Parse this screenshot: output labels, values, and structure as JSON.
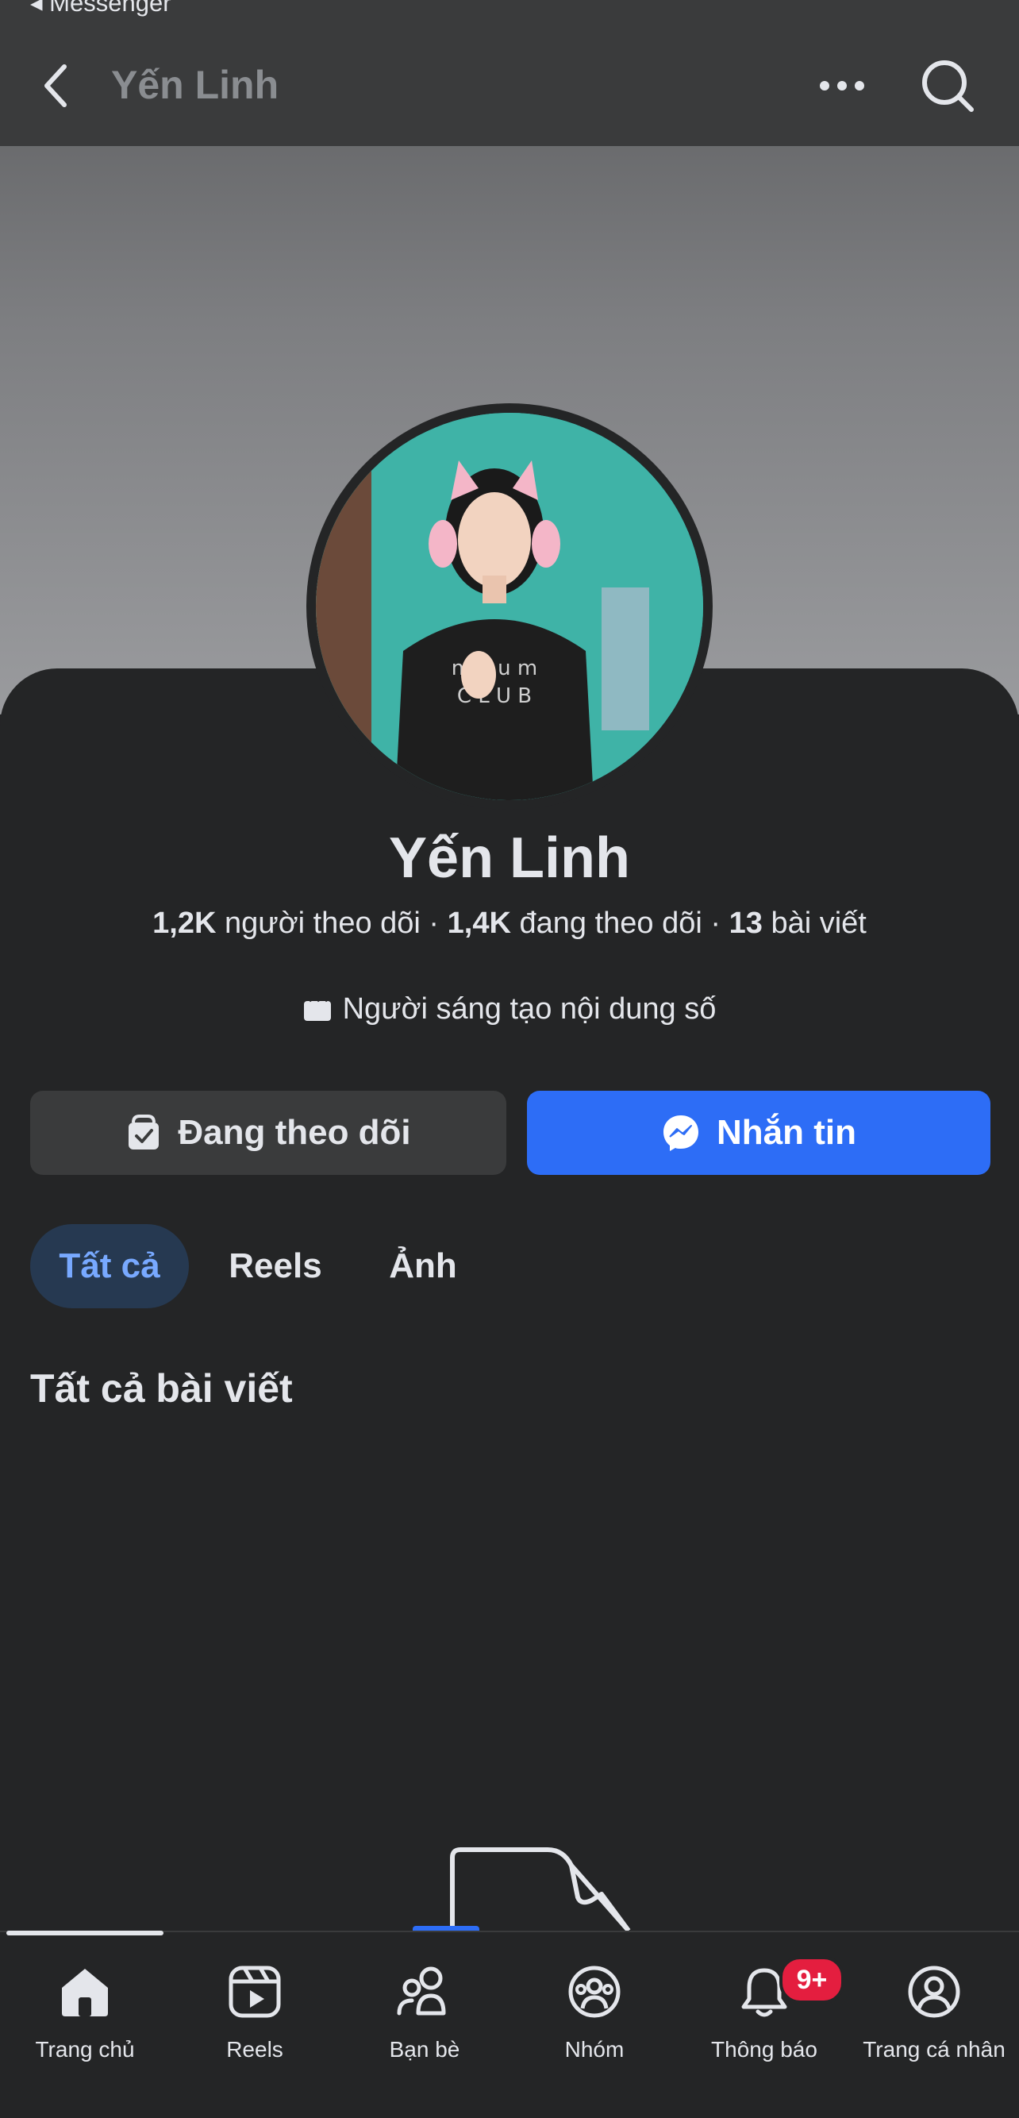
{
  "statusbar": {
    "back_app": "◂ Messenger"
  },
  "header": {
    "title": "Yến Linh"
  },
  "profile": {
    "name": "Yến Linh",
    "followers": "1,2K",
    "followers_label": "người theo dõi",
    "following": "1,4K",
    "following_label": "đang theo dõi",
    "posts": "13",
    "posts_label": "bài viết",
    "separator": "·",
    "category": "Người sáng tạo nội dung số"
  },
  "actions": {
    "following_label": "Đang theo dõi",
    "message_label": "Nhắn tin"
  },
  "tabs": [
    {
      "label": "Tất cả",
      "active": true
    },
    {
      "label": "Reels",
      "active": false
    },
    {
      "label": "Ảnh",
      "active": false
    }
  ],
  "section": {
    "title": "Tất cả bài viết"
  },
  "bottom_nav": [
    {
      "label": "Trang chủ",
      "icon": "home-icon",
      "active": true
    },
    {
      "label": "Reels",
      "icon": "reels-icon"
    },
    {
      "label": "Bạn bè",
      "icon": "friends-icon"
    },
    {
      "label": "Nhóm",
      "icon": "groups-icon"
    },
    {
      "label": "Thông báo",
      "icon": "bell-icon",
      "badge": "9+"
    },
    {
      "label": "Trang cá nhân",
      "icon": "profile-icon"
    }
  ],
  "colors": {
    "background": "#242526",
    "header": "#3a3b3c",
    "accent": "#2d6df6",
    "active_tab_text": "#78a9ff",
    "badge": "#e41e3f"
  }
}
